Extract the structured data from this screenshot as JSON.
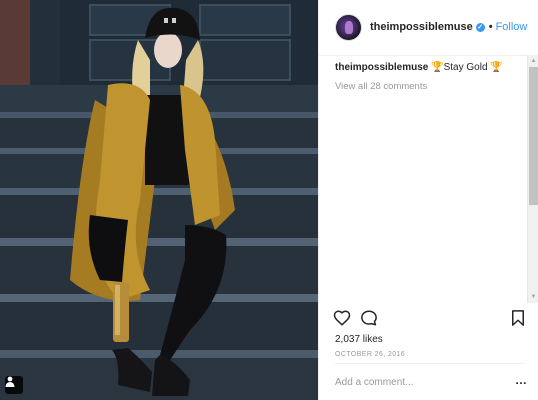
{
  "post": {
    "username": "theimpossiblemuse",
    "verified_glyph": "✓",
    "separator": "•",
    "follow_label": "Follow",
    "caption_username": "theimpossiblemuse",
    "caption_text": " 🏆Stay Gold 🏆",
    "view_all_comments": "View all 28 comments",
    "likes": "2,037 likes",
    "date": "OCTOBER 26, 2016",
    "comment_placeholder": "Add a comment...",
    "more_options": "…"
  },
  "icons": {
    "like": "heart-icon",
    "comment": "speech-bubble-icon",
    "save": "bookmark-icon",
    "user_tag": "person-icon",
    "scroll_up": "arrow-up-icon",
    "scroll_down": "arrow-down-icon"
  },
  "colors": {
    "link_blue": "#3897f0",
    "muted_gray": "#999999",
    "text_dark": "#262626",
    "coat_mustard": "#b38a2a"
  }
}
